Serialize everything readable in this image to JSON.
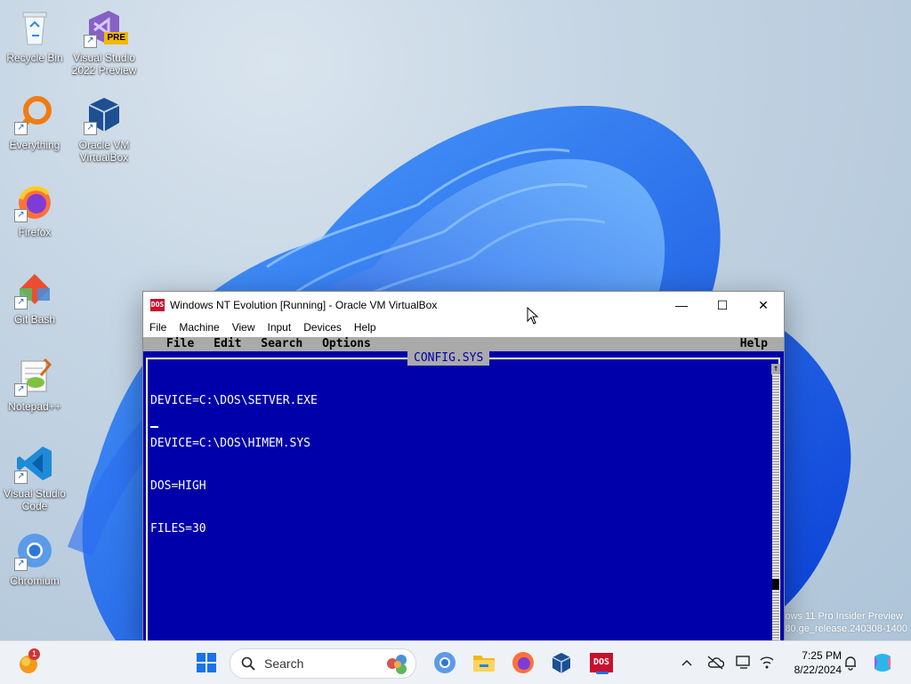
{
  "desktop": {
    "icons": [
      {
        "label": "Recycle Bin"
      },
      {
        "label": "Visual Studio 2022 Preview",
        "badge": "PRE"
      },
      {
        "label": "Everything"
      },
      {
        "label": "Oracle VM VirtualBox"
      },
      {
        "label": "Firefox"
      },
      {
        "label": "Git Bash"
      },
      {
        "label": "Notepad++"
      },
      {
        "label": "Visual Studio Code"
      },
      {
        "label": "Chromium"
      }
    ],
    "watermark_line1": "ows 11 Pro Insider Preview",
    "watermark_line2": "80.ge_release.240308-1400"
  },
  "vbox": {
    "app_icon_text": "DOS",
    "title": "Windows NT Evolution [Running] - Oracle VM VirtualBox",
    "menu": [
      "File",
      "Machine",
      "View",
      "Input",
      "Devices",
      "Help"
    ],
    "controls": {
      "minimize": "—",
      "maximize": "☐",
      "close": "✕"
    }
  },
  "dos": {
    "menu": [
      "File",
      "Edit",
      "Search",
      "Options"
    ],
    "help": "Help",
    "filename": "CONFIG.SYS",
    "lines": [
      "DEVICE=C:\\DOS\\SETVER.EXE",
      "DEVICE=C:\\DOS\\HIMEM.SYS",
      "DOS=HIGH",
      "FILES=30"
    ],
    "scroll_up": "↑"
  },
  "taskbar": {
    "search_placeholder": "Search",
    "notification_badge": "1",
    "dos_label": "DOS",
    "time": "7:25 PM",
    "date": "8/22/2024",
    "colors": {
      "accent": "#1a73e8",
      "dos_blue": "#0000aa",
      "dos_gray": "#aaaaaa"
    }
  }
}
